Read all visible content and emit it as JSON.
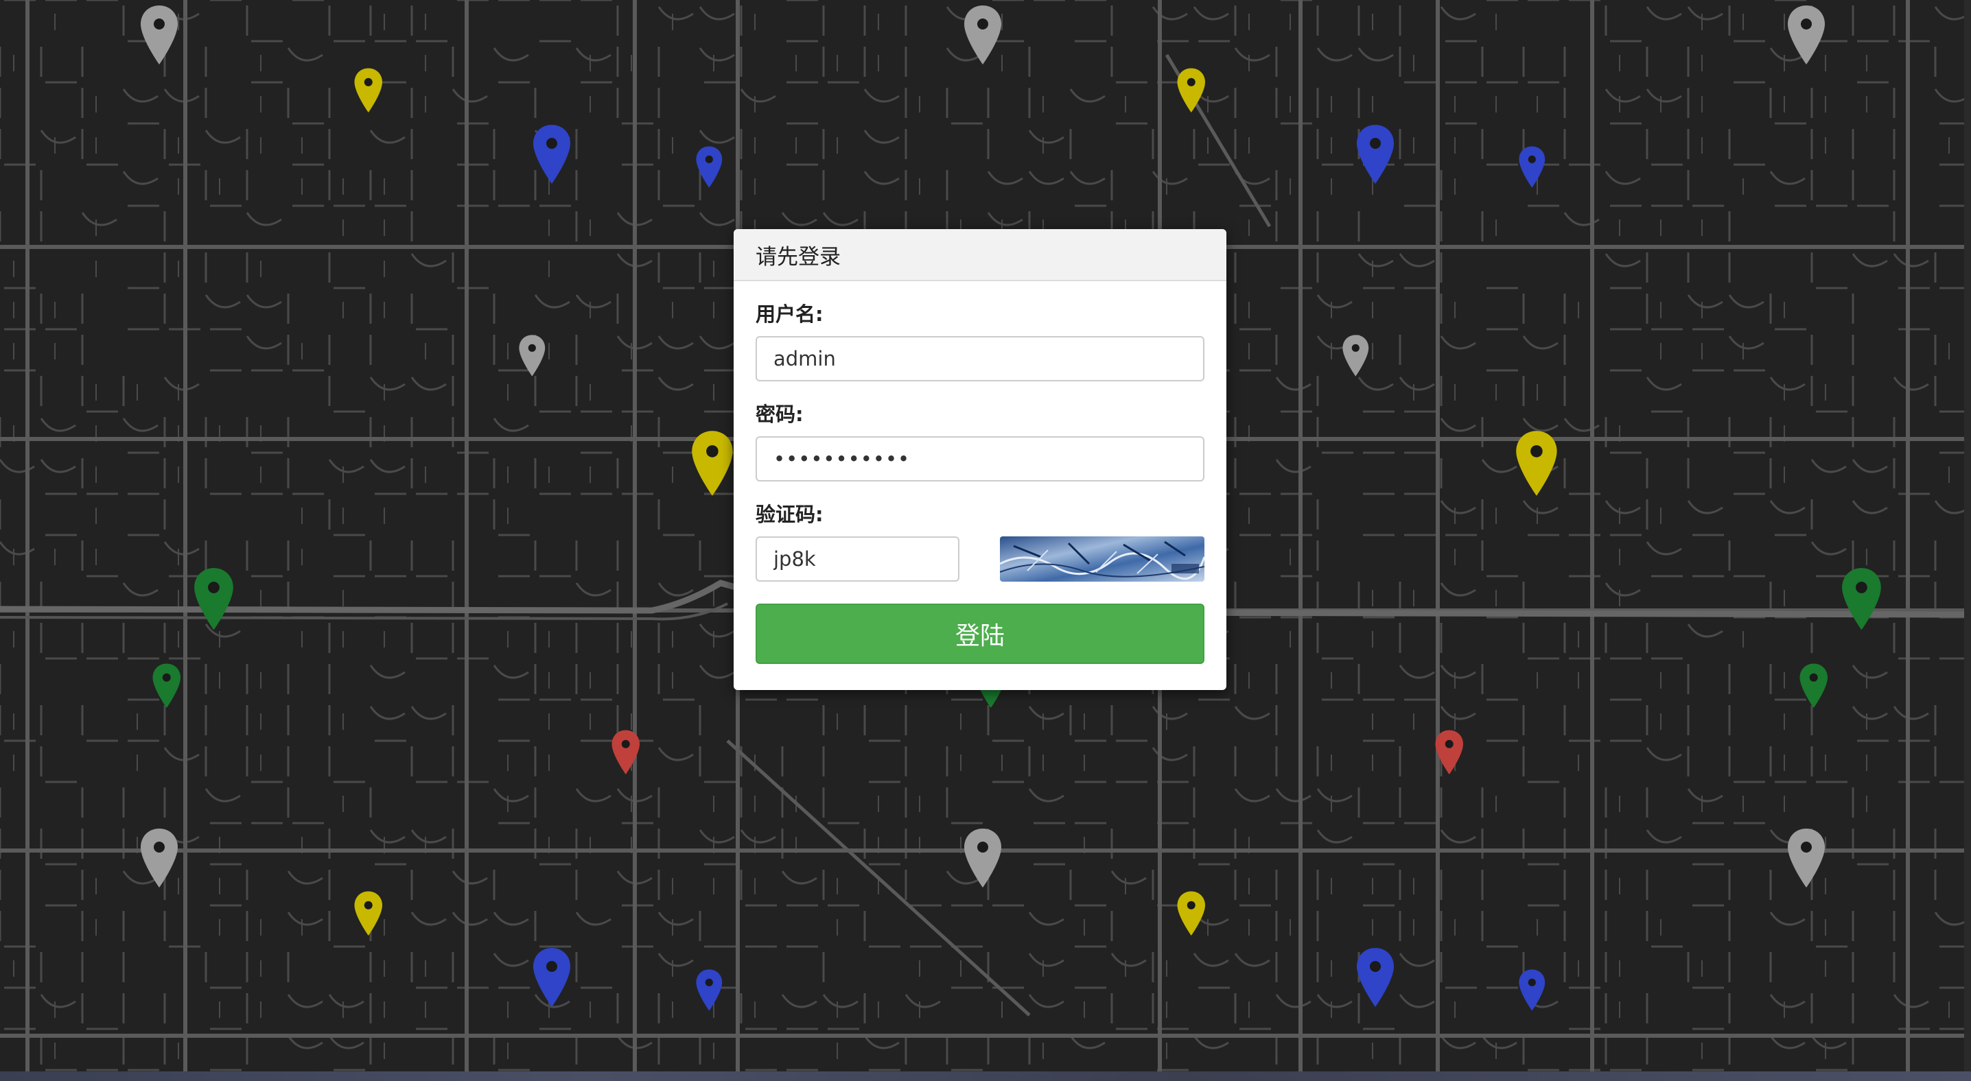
{
  "map": {
    "background_color": "#222222",
    "road_color": "#4a4a4a",
    "pin_colors": {
      "gray": "#9e9e9e",
      "yellow": "#c8b800",
      "blue": "#2f44c8",
      "green": "#1a7a2e",
      "red": "#c0403c"
    },
    "marker_icon": "map-marker-icon"
  },
  "login": {
    "title": "请先登录",
    "username_label": "用户名:",
    "username_value": "admin",
    "password_label": "密码:",
    "password_value": "•••••••••••",
    "captcha_label": "验证码:",
    "captcha_value": "jp8k",
    "button_label": "登陆",
    "button_color": "#4cae4c"
  }
}
